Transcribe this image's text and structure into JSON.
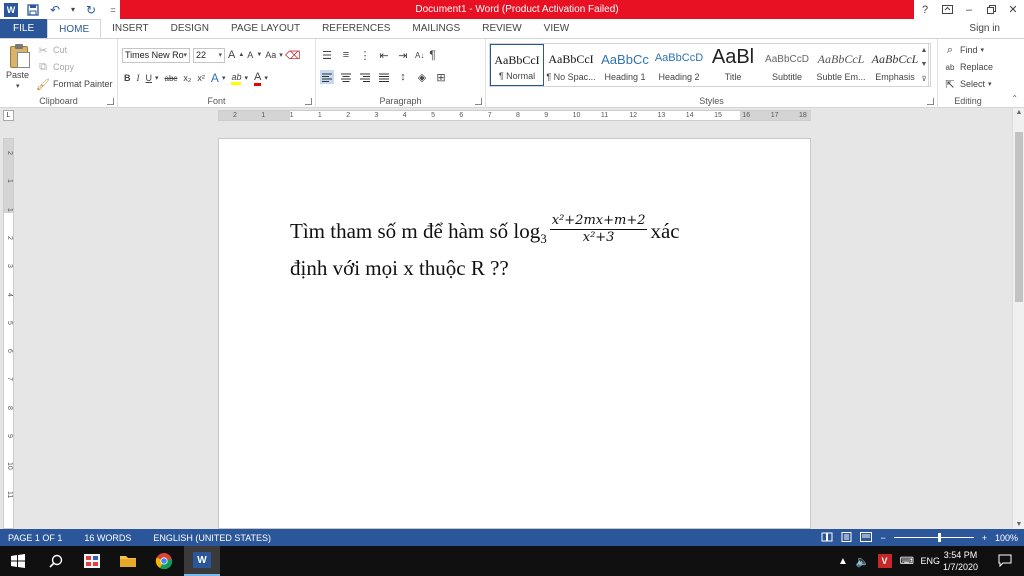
{
  "window": {
    "title": "Document1 - Word (Product Activation Failed)",
    "help": "?",
    "sign_in": "Sign in"
  },
  "qat": {
    "undo_dropdown": "▾",
    "customize": "="
  },
  "tabs": [
    {
      "label": "FILE"
    },
    {
      "label": "HOME"
    },
    {
      "label": "INSERT"
    },
    {
      "label": "DESIGN"
    },
    {
      "label": "PAGE LAYOUT"
    },
    {
      "label": "REFERENCES"
    },
    {
      "label": "MAILINGS"
    },
    {
      "label": "REVIEW"
    },
    {
      "label": "VIEW"
    }
  ],
  "clipboard": {
    "paste": "Paste",
    "cut": "Cut",
    "copy": "Copy",
    "format_painter": "Format Painter",
    "label": "Clipboard"
  },
  "font": {
    "name": "Times New Ro",
    "size": "22",
    "grow": "A",
    "shrink": "A",
    "case": "Aa",
    "bold": "B",
    "italic": "I",
    "underline": "U",
    "strike": "abc",
    "subscript": "x₂",
    "superscript": "x²",
    "effects": "A",
    "highlight": "ab",
    "color": "A",
    "label": "Font"
  },
  "paragraph": {
    "label": "Paragraph",
    "show_marks": "¶",
    "sort": "A↓"
  },
  "styles": {
    "label": "Styles",
    "items": [
      {
        "preview": "AaBbCcI",
        "name": "¶ Normal"
      },
      {
        "preview": "AaBbCcI",
        "name": "¶ No Spac..."
      },
      {
        "preview": "AaBbCc",
        "name": "Heading 1"
      },
      {
        "preview": "AaBbCcD",
        "name": "Heading 2"
      },
      {
        "preview": "AaBl",
        "name": "Title"
      },
      {
        "preview": "AaBbCcD",
        "name": "Subtitle"
      },
      {
        "preview": "AaBbCcL",
        "name": "Subtle Em..."
      },
      {
        "preview": "AaBbCcL",
        "name": "Emphasis"
      }
    ]
  },
  "editing": {
    "find": "Find",
    "replace": "Replace",
    "select": "Select",
    "label": "Editing"
  },
  "ruler": {
    "tab_selector": "L",
    "h_numbers": [
      "2",
      "1",
      "1",
      "1",
      "2",
      "3",
      "4",
      "5",
      "6",
      "7",
      "8",
      "9",
      "10",
      "11",
      "12",
      "13",
      "14",
      "15",
      "16",
      "17",
      "18"
    ],
    "v_numbers": [
      "2",
      "1",
      "1",
      "2",
      "3",
      "4",
      "5",
      "6",
      "7",
      "8",
      "9",
      "10",
      "11"
    ]
  },
  "document": {
    "line1_text": "Tìm tham số m để hàm số log",
    "log_base": "3",
    "fraction_num": "x²+2mx+m+2",
    "fraction_den": "x²+3",
    "line1_end": "xác",
    "line2_text": "định với mọi x thuộc R ??"
  },
  "status": {
    "page": "PAGE 1 OF 1",
    "words": "16 WORDS",
    "language": "ENGLISH (UNITED STATES)",
    "zoom_minus": "−",
    "zoom_plus": "+",
    "zoom": "100%"
  },
  "taskbar": {
    "lang": "ENG",
    "time": "3:54 PM",
    "date": "1/7/2020"
  },
  "colors": {
    "accent": "#2b579a",
    "title_red": "#e81123",
    "taskbar": "#101010"
  }
}
